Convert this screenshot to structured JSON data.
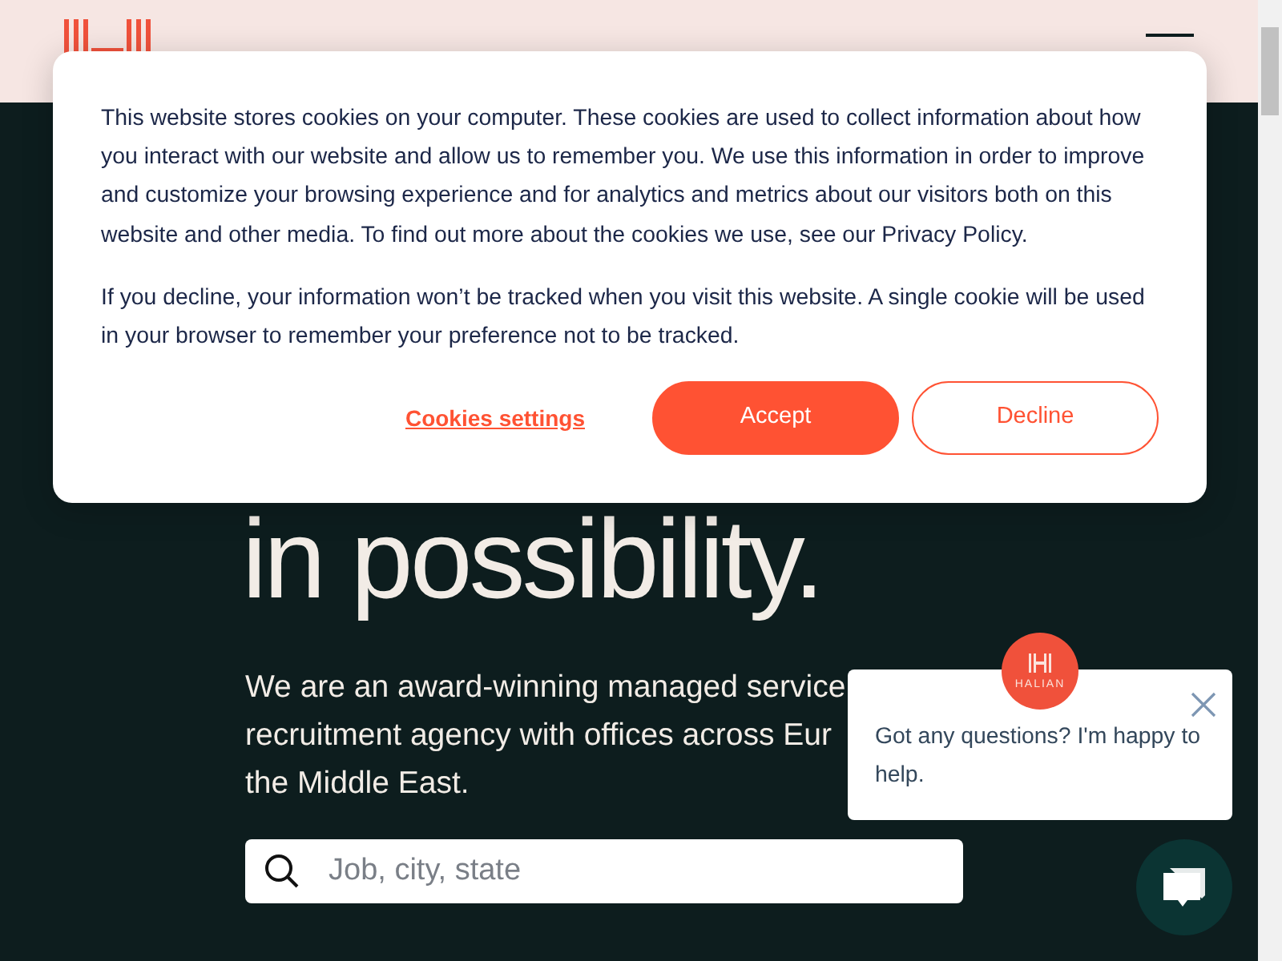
{
  "hero": {
    "heading": "in possibility.",
    "intro_lines": [
      "We are an award-winning managed service",
      "recruitment agency with offices across Eur",
      "the Middle East."
    ],
    "search": {
      "placeholder": "Job, city, state"
    }
  },
  "cookie_banner": {
    "paragraphs": [
      "This website stores cookies on your computer. These cookies are used to collect information about how you interact with our website and allow us to remember you. We use this information in order to improve and customize your browsing experience and for analytics and metrics about our visitors both on this website and other media. To find out more about the cookies we use, see our Privacy Policy.",
      "If you decline, your information won’t be tracked when you visit this website. A single cookie will be used in your browser to remember your preference not to be tracked."
    ],
    "settings_link": "Cookies settings",
    "buttons": [
      {
        "label": "Accept",
        "kind": "primary"
      },
      {
        "label": "Decline",
        "kind": "outline"
      }
    ]
  },
  "chat": {
    "avatar_text": "HALIAN",
    "message": "Got any questions? I'm happy to help."
  }
}
